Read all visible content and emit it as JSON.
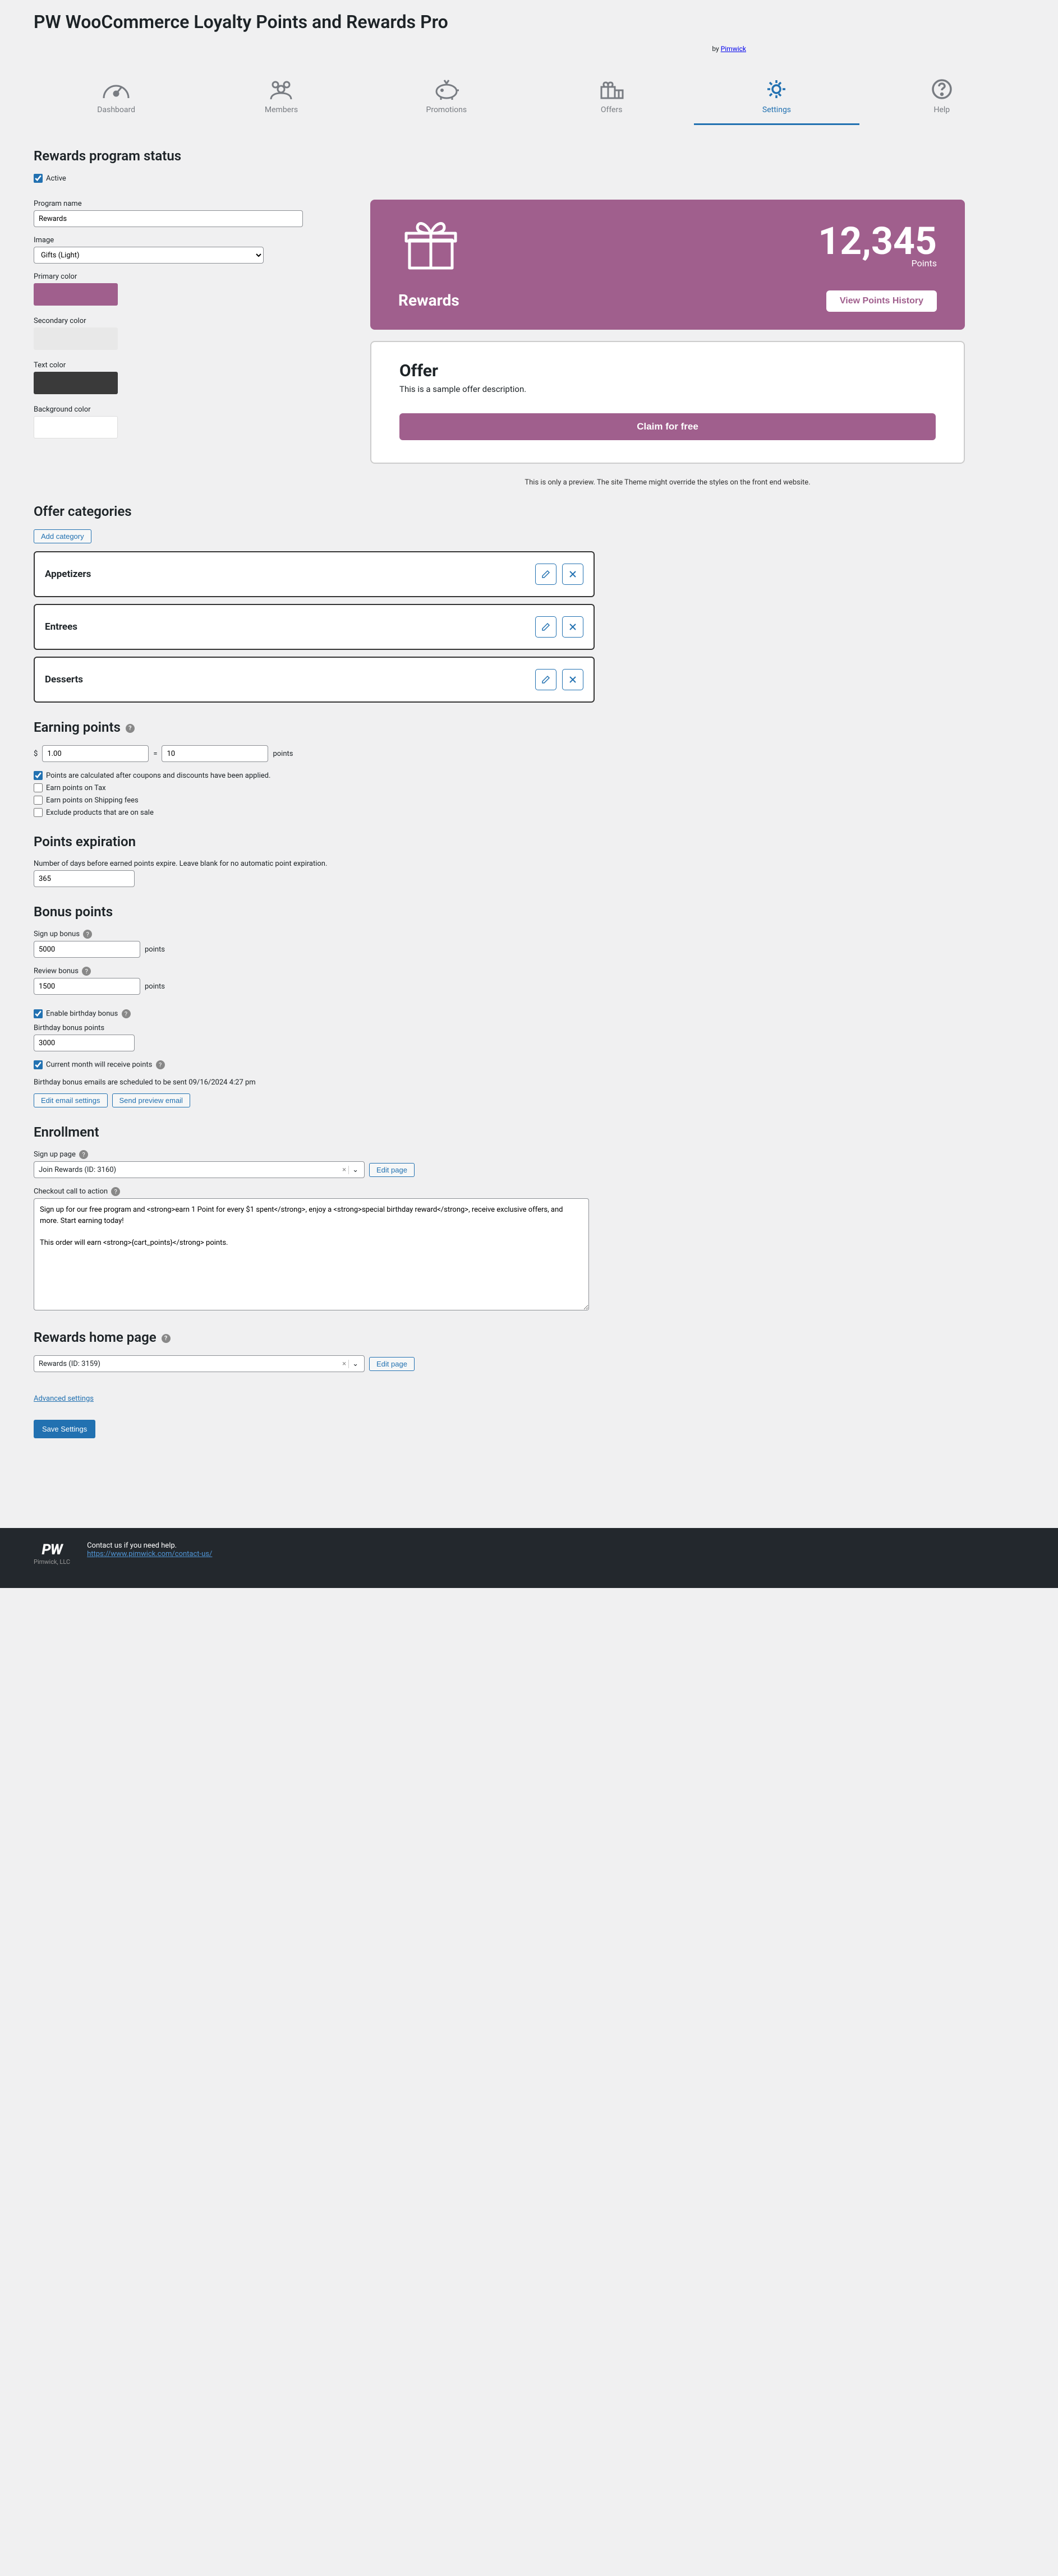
{
  "header": {
    "title": "PW WooCommerce Loyalty Points and Rewards Pro",
    "by_prefix": "by ",
    "by_link": "Pimwick"
  },
  "tabs": {
    "dashboard": "Dashboard",
    "members": "Members",
    "promotions": "Promotions",
    "offers": "Offers",
    "settings": "Settings",
    "help": "Help"
  },
  "status": {
    "heading": "Rewards program status",
    "active_label": "Active",
    "program_name_label": "Program name",
    "program_name_value": "Rewards",
    "image_label": "Image",
    "image_value": "Gifts (Light)",
    "primary_color_label": "Primary color",
    "primary_color": "#a05f8d",
    "secondary_color_label": "Secondary color",
    "secondary_color": "#e8e8e8",
    "text_color_label": "Text color",
    "text_color": "#3a3a3a",
    "background_color_label": "Background color",
    "background_color": "#ffffff"
  },
  "preview": {
    "points": "12,345",
    "points_label": "Points",
    "program_name": "Rewards",
    "history_btn": "View Points History",
    "offer_title": "Offer",
    "offer_desc": "This is a sample offer description.",
    "claim_btn": "Claim for free",
    "note": "This is only a preview. The site Theme might override the styles on the front end website."
  },
  "categories": {
    "heading": "Offer categories",
    "add_btn": "Add category",
    "items": [
      {
        "name": "Appetizers"
      },
      {
        "name": "Entrees"
      },
      {
        "name": "Desserts"
      }
    ]
  },
  "earning": {
    "heading": "Earning points",
    "currency": "$",
    "amount": "1.00",
    "equals": "=",
    "points": "10",
    "points_suffix": "points",
    "chk_after_coupons": "Points are calculated after coupons and discounts have been applied.",
    "chk_tax": "Earn points on Tax",
    "chk_shipping": "Earn points on Shipping fees",
    "chk_exclude_sale": "Exclude products that are on sale"
  },
  "expiration": {
    "heading": "Points expiration",
    "desc": "Number of days before earned points expire. Leave blank for no automatic point expiration.",
    "value": "365"
  },
  "bonus": {
    "heading": "Bonus points",
    "signup_label": "Sign up bonus",
    "signup_value": "5000",
    "review_label": "Review bonus",
    "review_value": "1500",
    "points_suffix": "points",
    "enable_birthday": "Enable birthday bonus",
    "birthday_points_label": "Birthday bonus points",
    "birthday_points_value": "3000",
    "current_month": "Current month will receive points",
    "schedule_text": "Birthday bonus emails are scheduled to be sent 09/16/2024 4:27 pm",
    "edit_email_btn": "Edit email settings",
    "preview_email_btn": "Send preview email"
  },
  "enrollment": {
    "heading": "Enrollment",
    "signup_page_label": "Sign up page",
    "signup_page_value": "Join Rewards (ID: 3160)",
    "edit_page_btn": "Edit page",
    "cta_label": "Checkout call to action",
    "cta_value": "Sign up for our free program and <strong>earn 1 Point for every $1 spent</strong>, enjoy a <strong>special birthday reward</strong>, receive exclusive offers, and more. Start earning today!\n\nThis order will earn <strong>{cart_points}</strong> points."
  },
  "home": {
    "heading": "Rewards home page",
    "page_value": "Rewards (ID: 3159)",
    "edit_page_btn": "Edit page"
  },
  "advanced_link": "Advanced settings",
  "save_btn": "Save Settings",
  "footer": {
    "logo_sub": "Pimwick, LLC",
    "contact": "Contact us if you need help.",
    "url": "https://www.pimwick.com/contact-us/"
  }
}
